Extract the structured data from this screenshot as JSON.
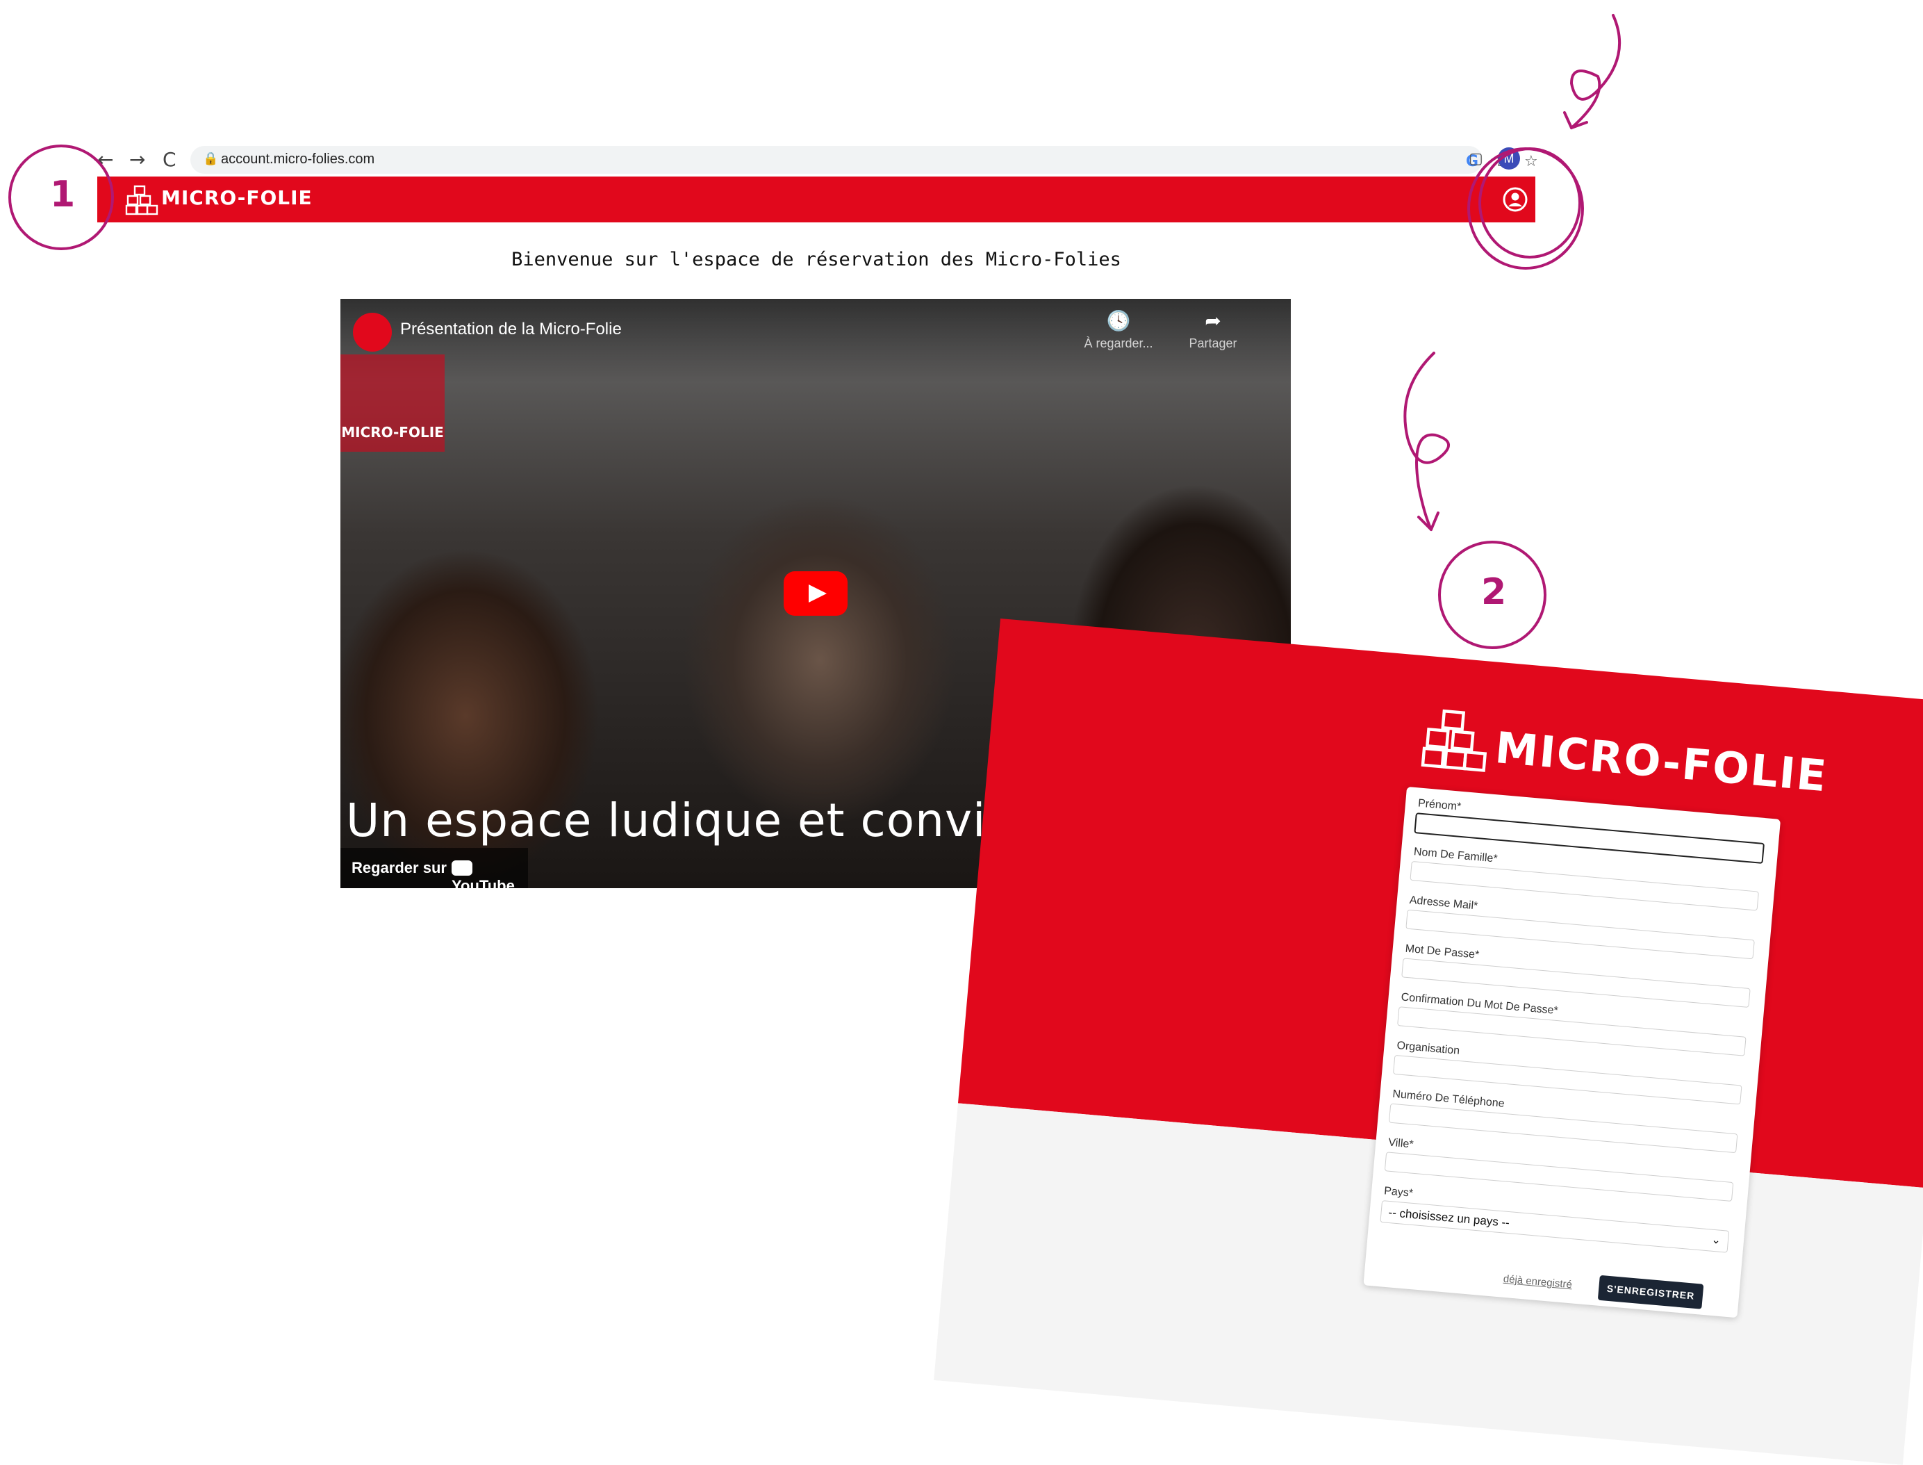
{
  "browser": {
    "back": "←",
    "forward": "→",
    "reload": "C",
    "url": "account.micro-folies.com",
    "icons": [
      "google-icon",
      "share-icon",
      "star-icon",
      "sidebar-icon"
    ],
    "profile_initial": "M"
  },
  "site": {
    "logo_text": "MICRO-FOLIE",
    "welcome": "Bienvenue sur l'espace de réservation des Micro-Folies"
  },
  "video": {
    "title": "Présentation de la Micro-Folie",
    "logo_overlay": "MICRO-FOLIE",
    "watch_later_icon": "🕓",
    "watch_later_label": "À regarder...",
    "share_icon": "➦",
    "share_label": "Partager",
    "caption": "Un espace ludique et convivial",
    "watch_on": "Regarder sur",
    "youtube": "YouTube"
  },
  "annotations": {
    "step1": "1",
    "step2": "2"
  },
  "register": {
    "logo_text": "MICRO-FOLIE",
    "fields": [
      {
        "label": "Prénom*"
      },
      {
        "label": "Nom De Famille*"
      },
      {
        "label": "Adresse Mail*"
      },
      {
        "label": "Mot De Passe*"
      },
      {
        "label": "Confirmation Du Mot De Passe*"
      },
      {
        "label": "Organisation"
      },
      {
        "label": "Numéro De Téléphone"
      },
      {
        "label": "Ville*"
      }
    ],
    "country_label": "Pays*",
    "country_value": "-- choisissez un pays --",
    "already_registered": "déjà enregistré",
    "submit": "S'ENREGISTRER"
  },
  "colors": {
    "brand_red": "#e1081c",
    "annotation": "#b01873",
    "submit_bg": "#1b2534"
  }
}
